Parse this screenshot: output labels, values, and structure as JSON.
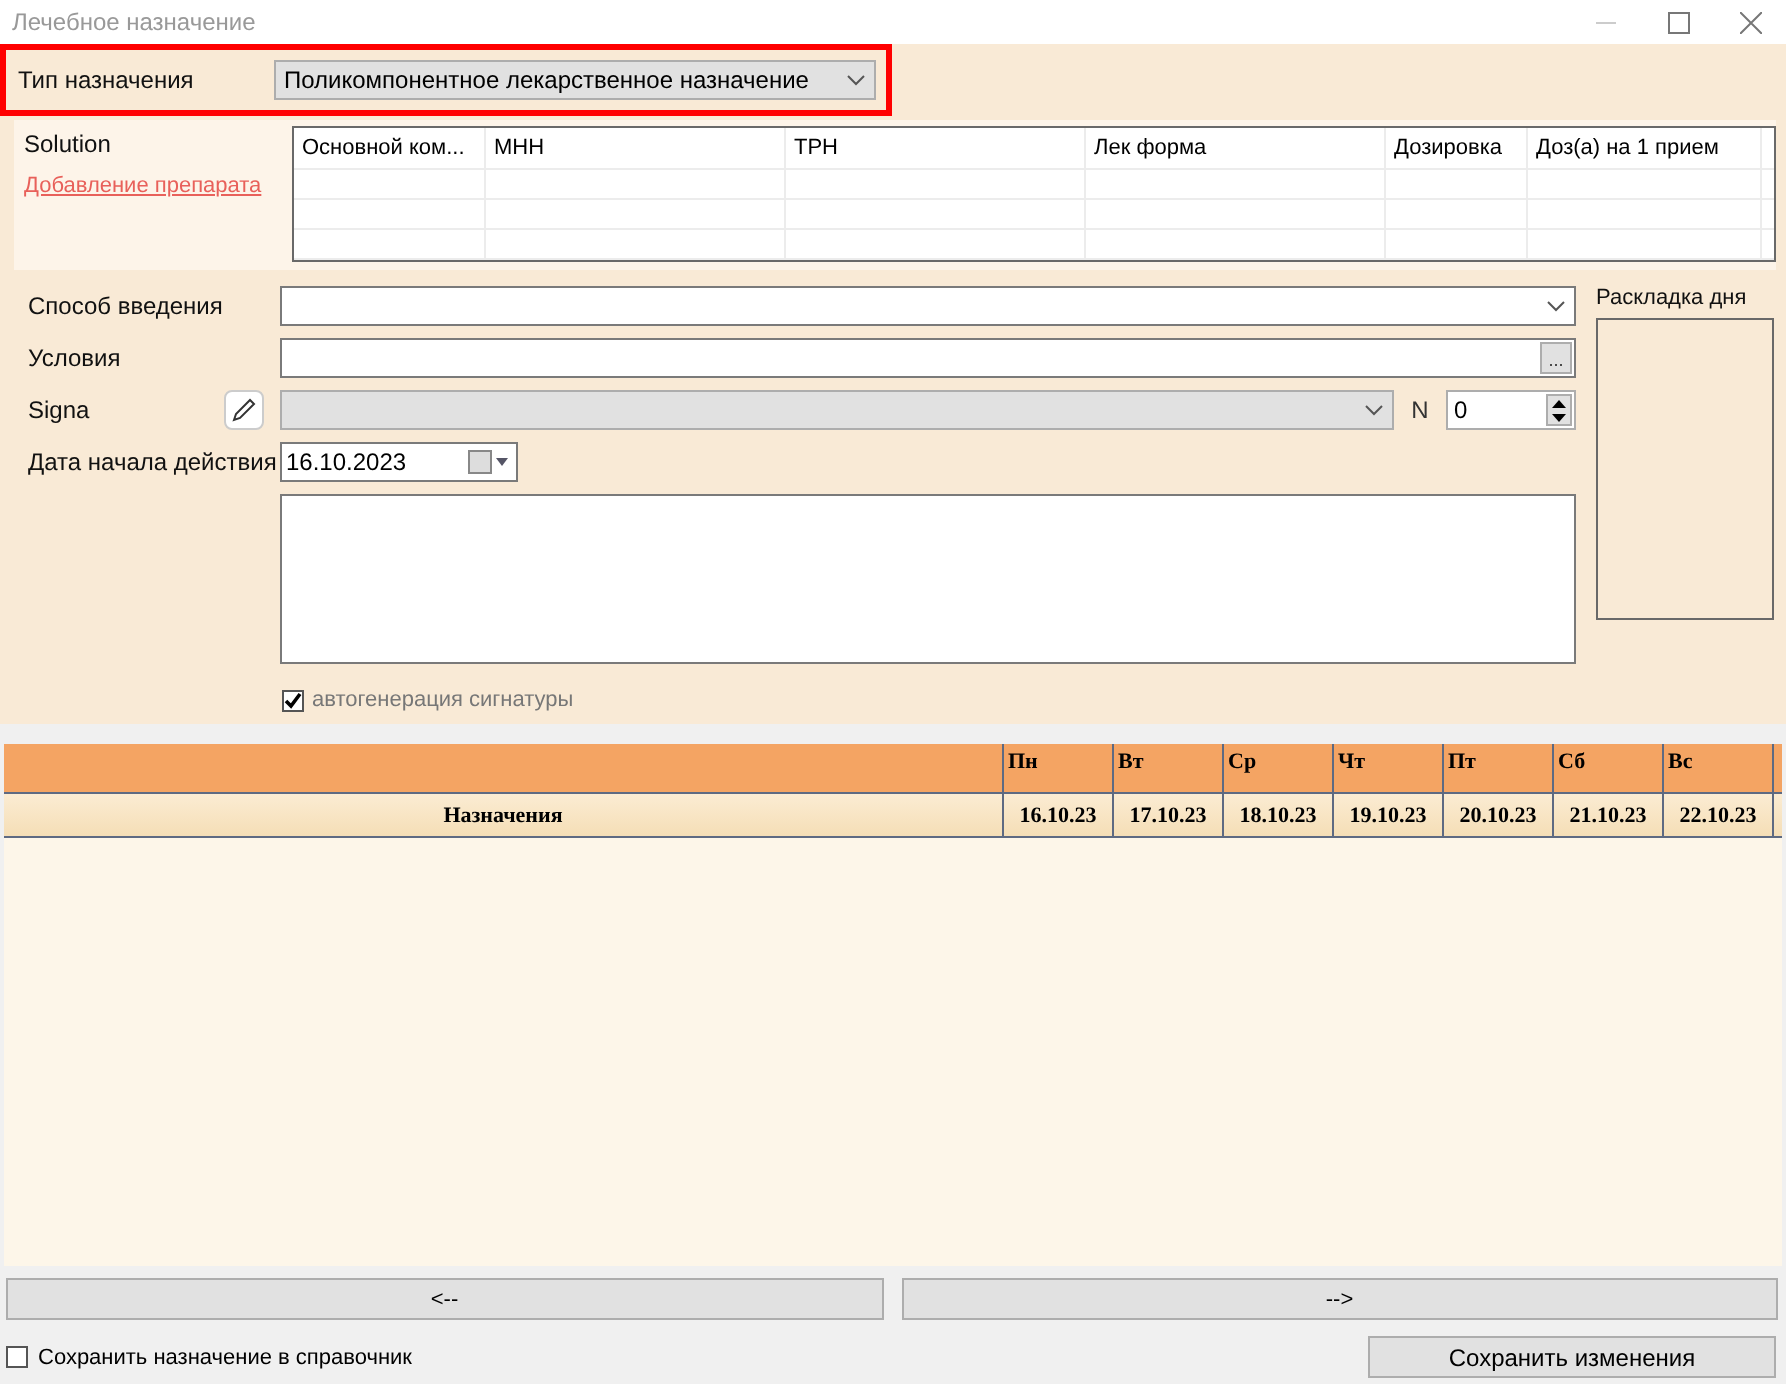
{
  "window": {
    "title": "Лечебное назначение"
  },
  "type_field": {
    "label": "Тип назначения",
    "value": "Поликомпонентное лекарственное назначение",
    "highlighted": true
  },
  "solution": {
    "label": "Solution",
    "add_link": "Добавление препарата",
    "columns": [
      "Основной ком...",
      "МНН",
      "ТРН",
      "Лек форма",
      "Дозировка",
      "Доз(а) на 1 прием"
    ]
  },
  "form": {
    "route": {
      "label": "Способ введения"
    },
    "conditions": {
      "label": "Условия",
      "browse": "..."
    },
    "signa": {
      "label": "Signa",
      "disabled": true,
      "n_label": "N",
      "n_value": "0"
    },
    "start_date": {
      "label": "Дата начала действия",
      "value": "16.10.2023"
    },
    "autogen": {
      "label": "автогенерация сигнатуры",
      "checked": true
    }
  },
  "day_layout": {
    "label": "Раскладка дня"
  },
  "schedule": {
    "label_column": "Назначения",
    "days": [
      {
        "weekday": "Пн",
        "date": "16.10.23"
      },
      {
        "weekday": "Вт",
        "date": "17.10.23"
      },
      {
        "weekday": "Ср",
        "date": "18.10.23"
      },
      {
        "weekday": "Чт",
        "date": "19.10.23"
      },
      {
        "weekday": "Пт",
        "date": "20.10.23"
      },
      {
        "weekday": "Сб",
        "date": "21.10.23"
      },
      {
        "weekday": "Вс",
        "date": "22.10.23"
      }
    ]
  },
  "nav_buttons": [
    "<--",
    "-->"
  ],
  "save_to_directory": {
    "label": "Сохранить назначение в справочник",
    "checked": false
  },
  "save_button": "Сохранить изменения"
}
